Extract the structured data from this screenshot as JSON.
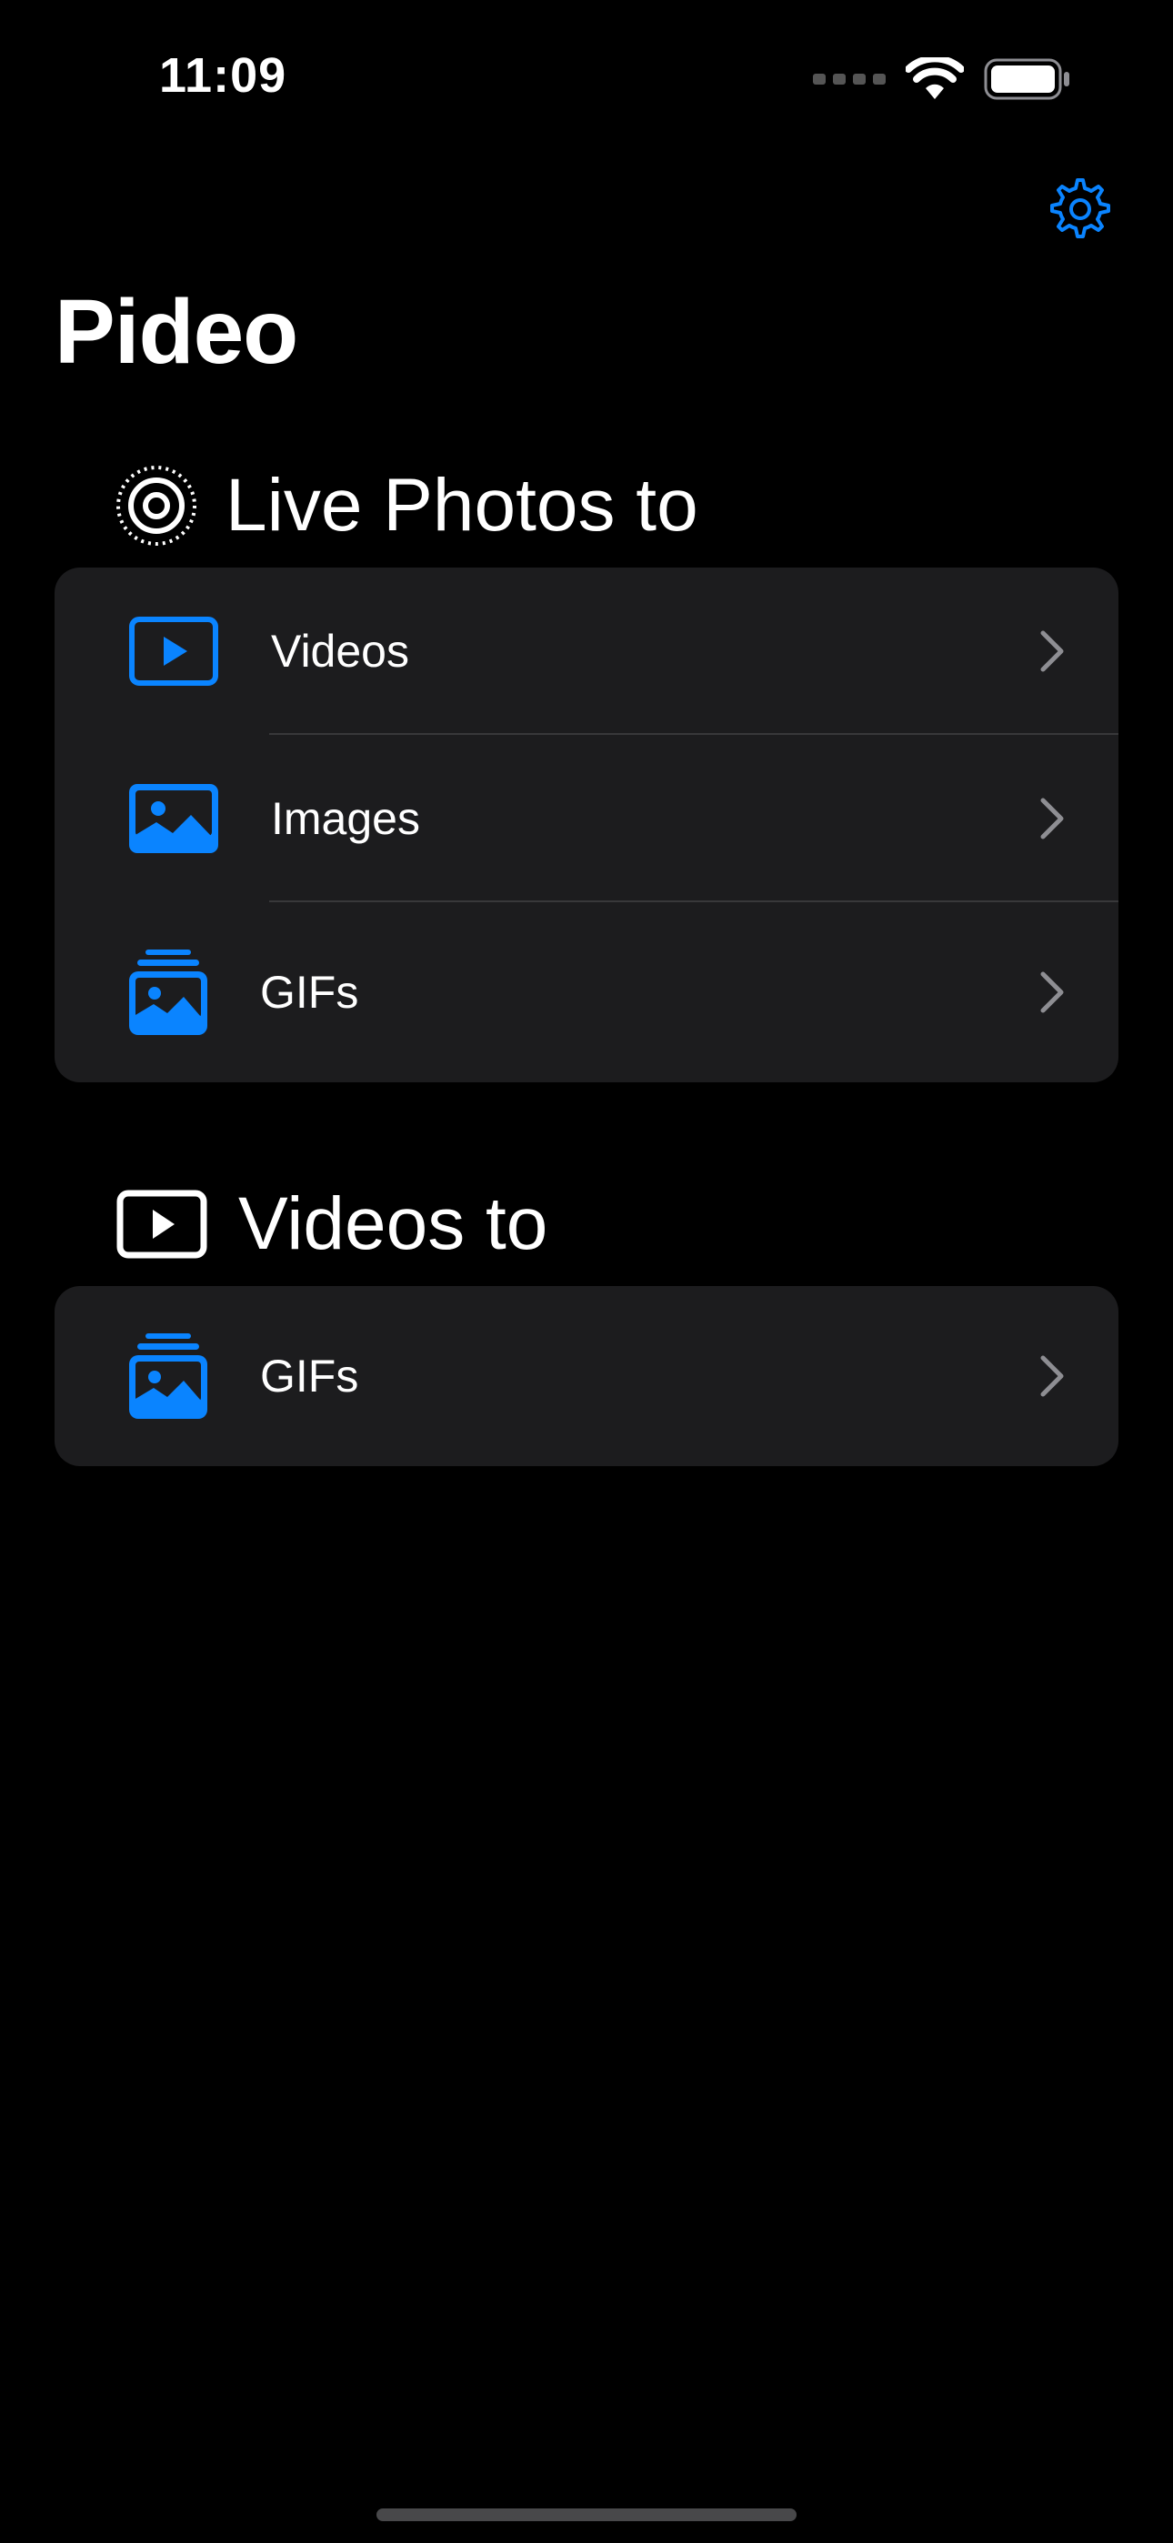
{
  "status_bar": {
    "time": "11:09"
  },
  "nav": {
    "settings_icon": "gear-icon",
    "title": "Pideo"
  },
  "colors": {
    "accent": "#0a84ff",
    "card": "#1c1c1e",
    "background": "#000000"
  },
  "sections": [
    {
      "title": "Live Photos to",
      "icon": "live-photo-icon",
      "items": [
        {
          "label": "Videos",
          "icon": "play-rectangle-icon"
        },
        {
          "label": "Images",
          "icon": "photo-icon"
        },
        {
          "label": "GIFs",
          "icon": "photo-stack-icon"
        }
      ]
    },
    {
      "title": "Videos to",
      "icon": "play-rectangle-icon",
      "items": [
        {
          "label": "GIFs",
          "icon": "photo-stack-icon"
        }
      ]
    }
  ]
}
